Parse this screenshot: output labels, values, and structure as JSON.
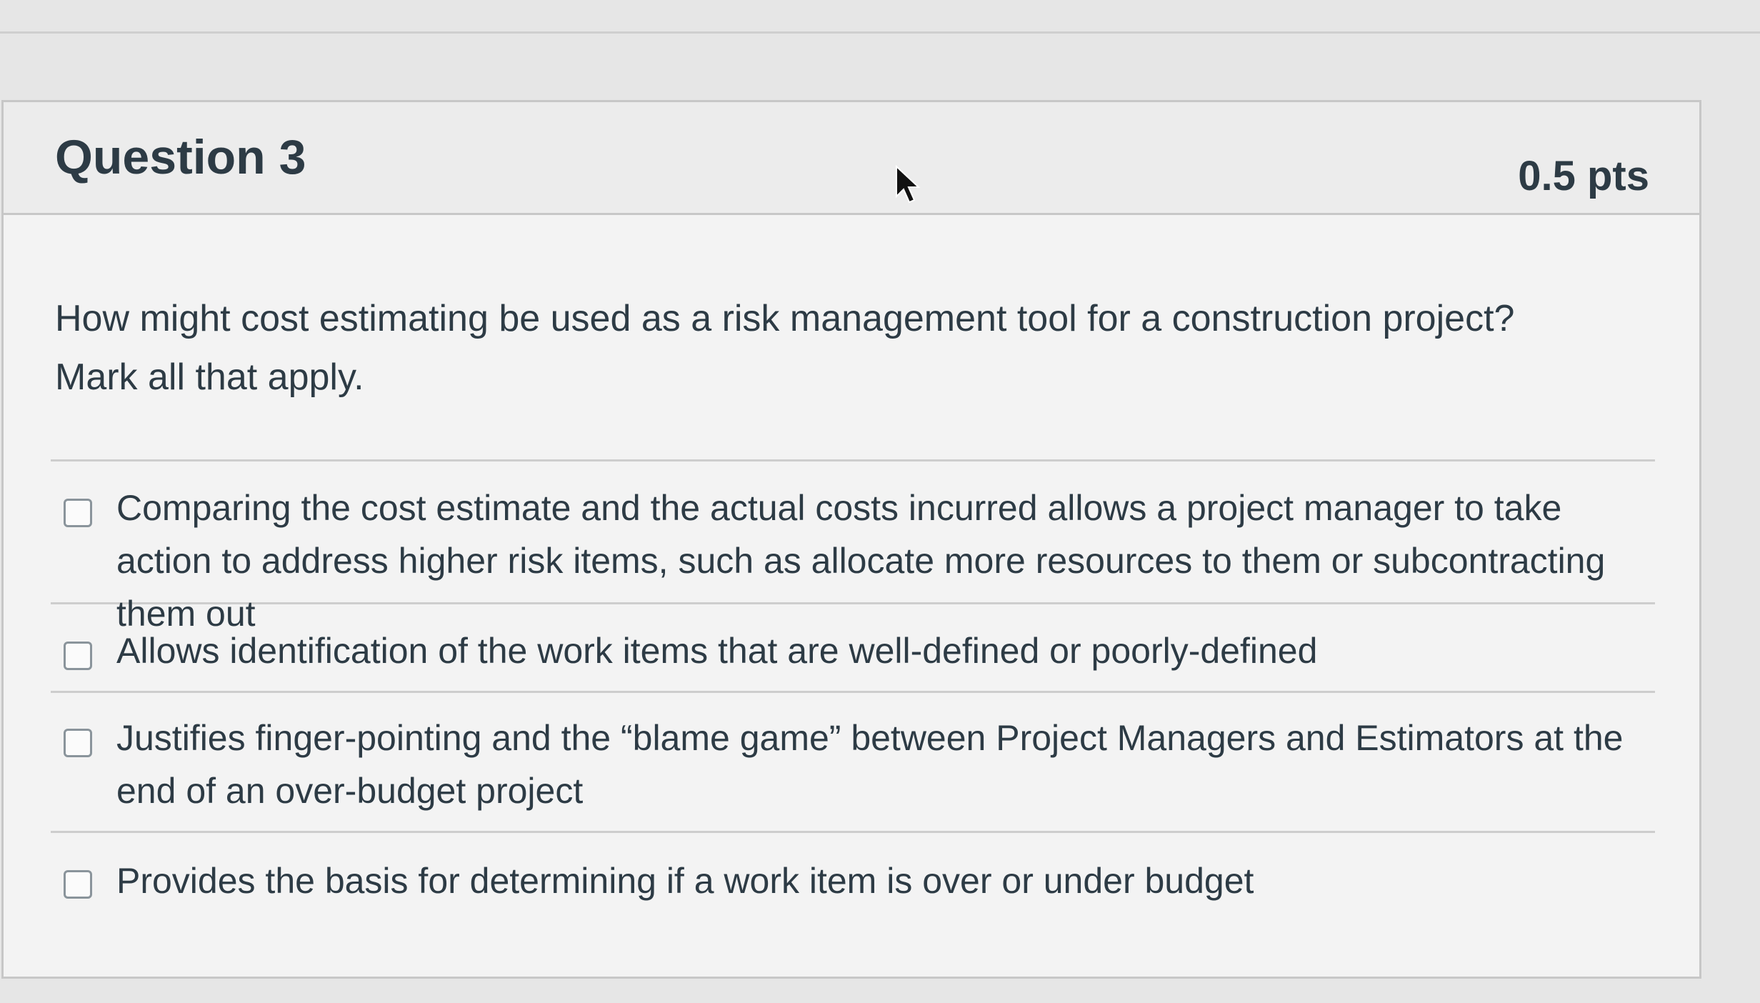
{
  "question": {
    "title": "Question 3",
    "points": "0.5 pts",
    "text_line1": "How might cost estimating be used as a risk management tool for a construction project?",
    "text_line2": "Mark all that apply."
  },
  "answers": [
    {
      "label": "Comparing the cost estimate and the actual costs incurred allows a project manager to take action to address higher risk items, such as allocate more resources to them or subcontracting them out",
      "checked": false
    },
    {
      "label": "Allows identification of the work items that are well-defined or poorly-defined",
      "checked": false
    },
    {
      "label": "Justifies finger-pointing and the “blame game” between Project Managers and Estimators at the end of an over-budget project",
      "checked": false
    },
    {
      "label": "Provides the basis for determining if a work item is over or under budget",
      "checked": false
    }
  ],
  "icons": {
    "cursor": "mouse-pointer-icon"
  }
}
